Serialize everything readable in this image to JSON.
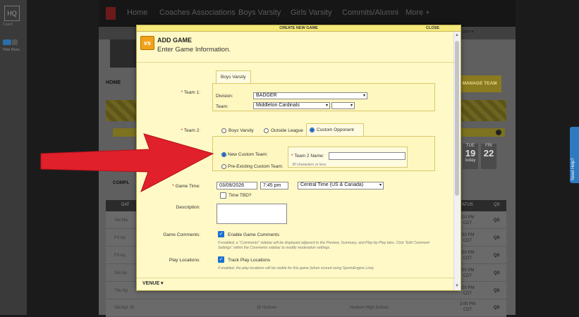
{
  "left_rail": {
    "logo": "HQ",
    "sub": "Coach",
    "menu_label": "Hide Menu"
  },
  "topnav": {
    "items": [
      "Home",
      "Coaches Associations",
      "Boys Varsity",
      "Girls Varsity",
      "Commits/Alumni",
      "More +"
    ]
  },
  "subnav": {
    "more": "ore ▾"
  },
  "background": {
    "home_label": "HOME",
    "manage_team": "MANAGE TEAM",
    "calendar": [
      {
        "dow": "TUE",
        "day": "19",
        "sub": "today"
      },
      {
        "dow": "FRI",
        "day": "22",
        "sub": ""
      }
    ],
    "completed_label": "COMPL",
    "table_headers": {
      "date": "DAT",
      "status": "TATUS",
      "qs": "QS"
    },
    "rows": [
      {
        "date": "Sat Ma",
        "status": ":00 PM CDT",
        "qs": "QS",
        "opp": "",
        "venue": ""
      },
      {
        "date": "Fri Ap",
        "status": ":30 PM CDT",
        "qs": "QS",
        "opp": "",
        "venue": ""
      },
      {
        "date": "Fri Ap",
        "status": ":00 PM CDT",
        "qs": "QS",
        "opp": "",
        "venue": ""
      },
      {
        "date": "Sat Ap",
        "status": ":00 PM CDT",
        "qs": "QS",
        "opp": "",
        "venue": ""
      },
      {
        "date": "Thu Ap",
        "status": ":00 PM CDT",
        "qs": "QS",
        "opp": "",
        "venue": ""
      },
      {
        "date": "Sat Apr 18",
        "status": "3:00 PM CDT",
        "qs": "QS",
        "opp": "@ Hudson",
        "venue": "Hudson High School"
      }
    ],
    "need_help": "Need Help?"
  },
  "modal": {
    "bar_title": "CREATE NEW GAME",
    "close": "CLOSE",
    "icon_text": "vs",
    "title": "ADD GAME",
    "subtitle": "Enter Game Information.",
    "team1": {
      "label": "Team 1:",
      "tab": "Boys Varsity",
      "division_label": "Division:",
      "division_value": "BADGER",
      "team_label": "Team:",
      "team_value": "Middleton Cardinals",
      "team_extra_value": ""
    },
    "team2": {
      "label": "Team 2:",
      "tabs": [
        "Boys Varsity",
        "Outside League",
        "Custom Opponent"
      ],
      "selected_tab": "Custom Opponent",
      "new_custom": "New Custom Team:",
      "pre_existing": "Pre-Existing Custom Team:",
      "name_label": "Team 2 Name:",
      "name_value": "",
      "name_hint": "30 characters or less."
    },
    "game_time": {
      "label": "Game Time:",
      "date": "03/09/2026",
      "time": "7:45 pm",
      "timezone": "Central Time (US & Canada)",
      "tbd_label": "Time TBD?"
    },
    "description": {
      "label": "Description:",
      "value": ""
    },
    "game_comments": {
      "label": "Game Comments:",
      "checkbox_label": "Enable Game Comments",
      "checked": true,
      "hint": "If enabled, a \"Comments\" sidebar will be displayed adjacent to the Preview, Summary, and Play-by-Play tabs. Click \"Edit Comment Settings\" within the Comments sidebar to modify moderation settings."
    },
    "play_locations": {
      "label": "Play Locations:",
      "checkbox_label": "Track Play Locations",
      "checked": true,
      "hint": "If enabled, the play locations will be visible for this game (when scored using SportsEngine Live)."
    },
    "venue_label": "VENUE ▾"
  },
  "colors": {
    "modal_bg": "#fff9c7",
    "accent_blue": "#1b6fd1",
    "arrow_red": "#e0202a",
    "required_red": "#d00000"
  }
}
